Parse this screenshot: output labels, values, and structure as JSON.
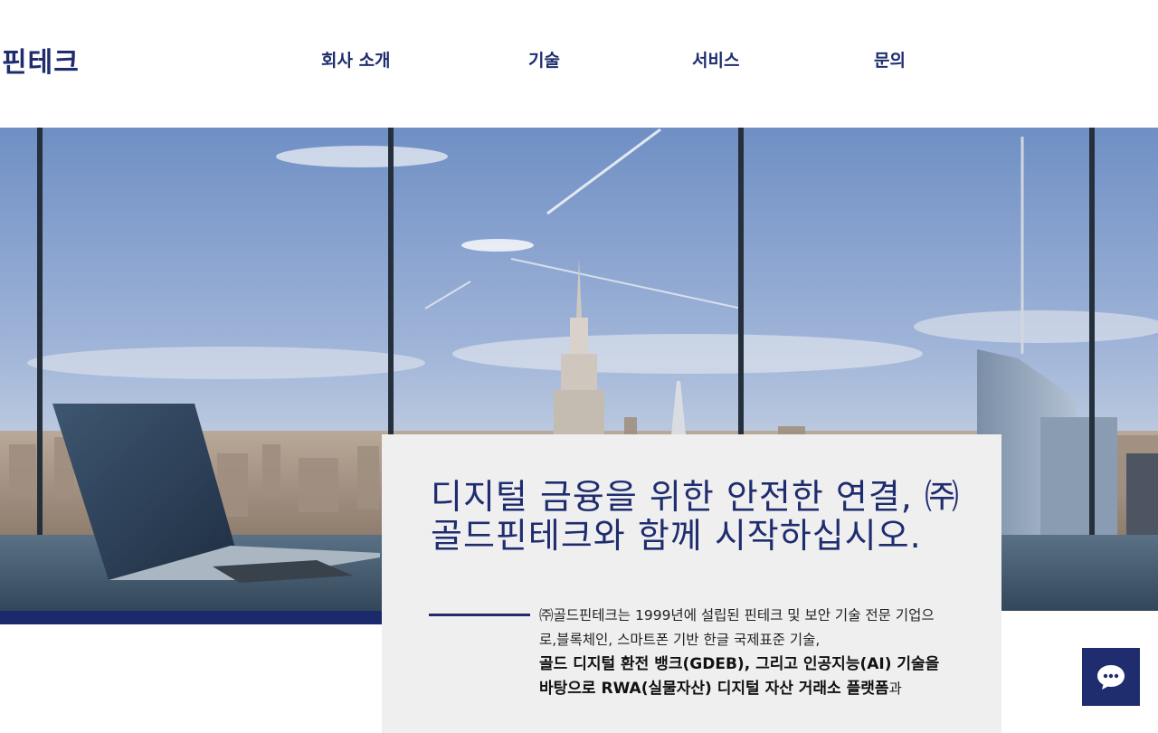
{
  "header": {
    "logo": "핀테크",
    "nav": [
      {
        "label": "회사 소개"
      },
      {
        "label": "기술"
      },
      {
        "label": "서비스"
      },
      {
        "label": "문의"
      }
    ]
  },
  "hero": {
    "image_description": "office-window-city-skyline-with-laptop"
  },
  "card": {
    "headline": "디지털 금융을 위한 안전한 연결, ㈜골드핀테크와 함께 시작하십시오.",
    "paragraph_intro": "㈜골드핀테크는 1999년에 설립된 핀테크 및 보안 기술 전문 기업으로,블록체인, 스마트폰 기반 한글 국제표준 기술,",
    "paragraph_bold": "골드 디지털 환전 뱅크(GDEB), 그리고 인공지능(AI) 기술을 바탕으로 RWA(실물자산) 디지털 자산 거래소 플랫폼",
    "paragraph_tail": "과"
  },
  "chat": {
    "icon": "chat-bubble-icon"
  },
  "colors": {
    "brand_navy": "#1f2d6e",
    "card_bg": "#efeff0",
    "stripe": "#1b2a6b"
  }
}
